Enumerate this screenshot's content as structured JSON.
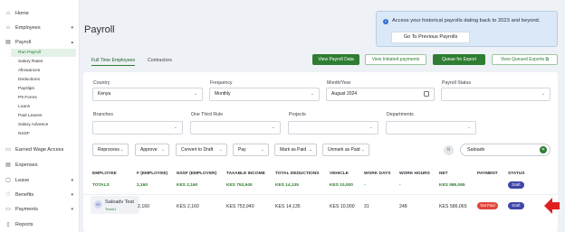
{
  "sidebar": {
    "items": [
      {
        "label": "Home",
        "icon": "home-icon",
        "glyph": "⌂"
      },
      {
        "label": "Employees",
        "icon": "users-icon",
        "glyph": "👥",
        "caret": "▾"
      },
      {
        "label": "Payroll",
        "icon": "payroll-icon",
        "glyph": "▤",
        "caret": "▴"
      },
      {
        "label": "Earned Wage Access",
        "icon": "wallet-icon",
        "glyph": "▭"
      },
      {
        "label": "Expenses",
        "icon": "receipt-icon",
        "glyph": "▤"
      },
      {
        "label": "Leave",
        "icon": "calendar-icon",
        "glyph": "▢",
        "caret": "▾"
      },
      {
        "label": "Benefits",
        "icon": "heart-icon",
        "glyph": "♡",
        "caret": "▾"
      },
      {
        "label": "Payments",
        "icon": "card-icon",
        "glyph": "▭",
        "caret": "▾"
      },
      {
        "label": "Reports",
        "icon": "report-icon",
        "glyph": "▯"
      }
    ],
    "payroll_sub": [
      "Run Payroll",
      "Salary Rates",
      "Allowances",
      "Deductions",
      "Payslips",
      "P9 Forms",
      "Loans",
      "Paid Leaves",
      "Salary Advance",
      "NSSF"
    ]
  },
  "page": {
    "title": "Payroll"
  },
  "banner": {
    "text": "Access your historical payrolls dating back to 2023 and beyond.",
    "button": "Go To Previous Payrolls",
    "info": "i"
  },
  "tabs": [
    "Full Time Employees",
    "Contractors"
  ],
  "toolbar": [
    "View Payroll Data",
    "View Initiated payments",
    "Queue for Export",
    "View Queued Exports ⧉"
  ],
  "filters": {
    "country": {
      "label": "Country",
      "value": "Kenya"
    },
    "frequency": {
      "label": "Frequency",
      "value": "Monthly"
    },
    "month": {
      "label": "Month/Year",
      "value": "August 2024"
    },
    "status": {
      "label": "Payroll Status",
      "value": ""
    },
    "branches": {
      "label": "Branches",
      "value": ""
    },
    "one_third": {
      "label": "One Third Rule",
      "value": ""
    },
    "projects": {
      "label": "Projects",
      "value": ""
    },
    "departments": {
      "label": "Departments",
      "value": ""
    }
  },
  "actions": [
    "Reprocess",
    "Approve",
    "Convert to Draft",
    "Pay",
    "Mark as Paid",
    "Unmark as Paid"
  ],
  "search": {
    "value": "Saloadv",
    "clear": "✕"
  },
  "table": {
    "headers": [
      "EMPLOYEE",
      "F (EMPLOYEE)",
      "NSSF (EMPLOYER)",
      "TAXABLE INCOME",
      "TOTAL DEDUCTIONS",
      "VEHICLE",
      "WORK DAYS",
      "WORK HOURS",
      "NET",
      "PAYMENT",
      "STATUS"
    ],
    "totals": [
      "TOTALS",
      "2,160",
      "KES 2,160",
      "KES 753,940",
      "KES 14,135",
      "KES 10,000",
      "-",
      "-",
      "KES 586,065",
      "",
      ""
    ],
    "rows": [
      {
        "avatar": "ST",
        "name": "Saloadv Test",
        "id": "Tresh1",
        "f_employee": "2,160",
        "nssf": "KES 2,160",
        "taxable": "KES 753,940",
        "deductions": "KES 14,135",
        "vehicle": "KES 10,000",
        "days": "31",
        "hours": "248",
        "net": "KES 586,065",
        "payment": "Not Paid",
        "status": "Draft"
      }
    ],
    "totals_status": "Draft"
  },
  "colors": {
    "accent": "#2e7d32",
    "not_paid": "#e0453a",
    "draft": "#3f46a8",
    "arrow": "#e02020"
  }
}
